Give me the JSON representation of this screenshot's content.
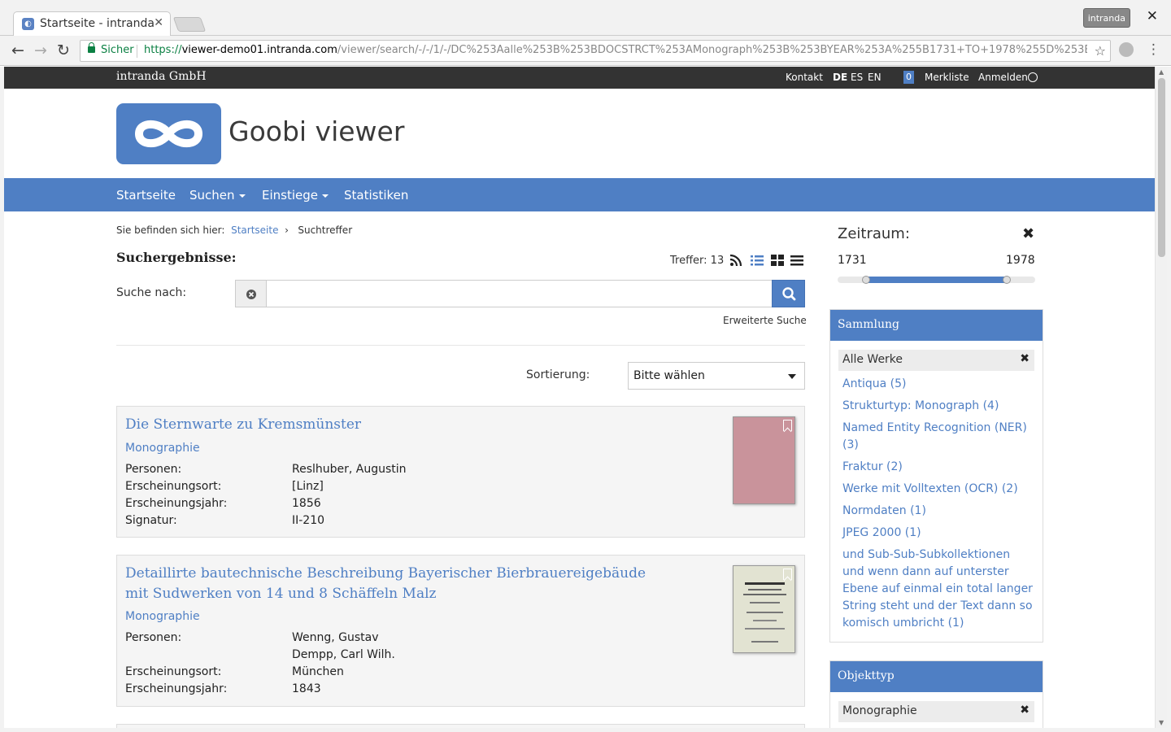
{
  "browser": {
    "tab_title": "Startseite - intranda",
    "profile": "intranda",
    "close_glyph": "✕",
    "secure_label": "Sicher",
    "url_scheme": "https://",
    "url_host": "viewer-demo01.intranda.com",
    "url_path": "/viewer/search/-/-/1/-/DC%253Aalle%253B%253BDOCSTRCT%253AMonograph%253B%253BYEAR%253A%255B1731+TO+1978%255D%253B%253..."
  },
  "topbar": {
    "brand": "intranda GmbH",
    "contact": "Kontakt",
    "languages": [
      "DE",
      "ES",
      "EN"
    ],
    "bookmark_count": "0",
    "bookmarks": "Merkliste",
    "login": "Anmelden"
  },
  "header": {
    "title": "Goobi viewer"
  },
  "nav": {
    "items": [
      "Startseite",
      "Suchen",
      "Einstiege",
      "Statistiken"
    ]
  },
  "breadcrumb": {
    "prefix": "Sie befinden sich hier:",
    "home": "Startseite",
    "separator": "›",
    "current": "Suchtreffer"
  },
  "search": {
    "heading": "Suchergebnisse:",
    "hits": "Treffer: 13",
    "label": "Suche nach:",
    "value": "",
    "advanced": "Erweiterte Suche",
    "sort_label": "Sortierung:",
    "sort_value": "Bitte wählen"
  },
  "results": [
    {
      "title": "Die Sternwarte zu Kremsmünster",
      "type": "Monographie",
      "meta": [
        {
          "key": "Personen:",
          "value": "Reslhuber, Augustin"
        },
        {
          "key": "Erscheinungsort:",
          "value": "[Linz]"
        },
        {
          "key": "Erscheinungsjahr:",
          "value": "1856"
        },
        {
          "key": "Signatur:",
          "value": "II-210"
        }
      ],
      "thumb_color": "#c9939b"
    },
    {
      "title": "Detaillirte bautechnische Beschreibung Bayerischer Bierbrauereigebäude mit Sudwerken von 14 und 8 Schäffeln Malz",
      "type": "Monographie",
      "meta": [
        {
          "key": "Personen:",
          "value": "Wenng, Gustav"
        },
        {
          "key": "",
          "value": "Dempp, Carl Wilh."
        },
        {
          "key": "Erscheinungsort:",
          "value": "München"
        },
        {
          "key": "Erscheinungsjahr:",
          "value": "1843"
        }
      ],
      "thumb_color": "#e2e3d2"
    }
  ],
  "sidebar": {
    "period": {
      "title": "Zeitraum:",
      "from": "1731",
      "to": "1978",
      "close": "✖"
    },
    "collection": {
      "title": "Sammlung",
      "active": "Alle Werke",
      "items": [
        "Antiqua (5)",
        "Strukturtyp: Monograph (4)",
        "Named Entity Recognition (NER) (3)",
        "Fraktur (2)",
        "Werke mit Volltexten (OCR) (2)",
        "Normdaten (1)",
        "JPEG 2000 (1)",
        "und Sub-Sub-Subkollektionen und wenn dann auf unterster Ebene auf einmal ein total langer String steht und der Text dann so komisch umbricht (1)"
      ]
    },
    "objecttype": {
      "title": "Objekttyp",
      "active": "Monographie"
    },
    "remove_glyph": "✖"
  },
  "colors": {
    "accent": "#4f7fc4",
    "topbar": "#333333",
    "secure": "#0b8043"
  }
}
